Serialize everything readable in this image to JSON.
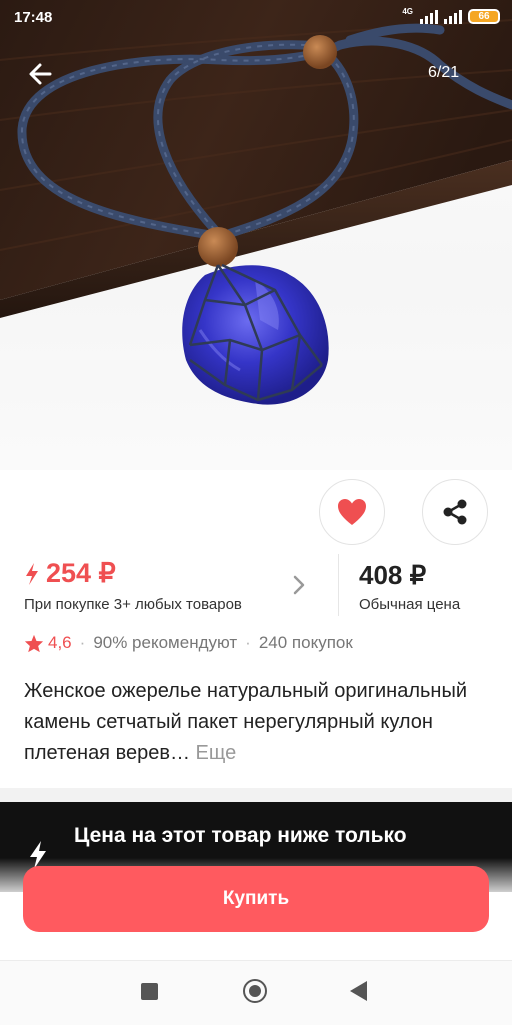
{
  "status": {
    "time": "17:48",
    "network": "4G",
    "battery": "66"
  },
  "gallery": {
    "counter": "6/21",
    "image_alt": "blue-crystal-necklace-photo"
  },
  "icons": {
    "back": "arrow-left-icon",
    "favorite": "heart-icon",
    "share": "share-icon",
    "promo": "lightning-icon",
    "chevron": "chevron-right-icon",
    "rating": "star-icon",
    "banner": "lightning-icon"
  },
  "price": {
    "promo": "254 ₽",
    "promo_condition": "При покупке 3+ любых товаров",
    "regular": "408 ₽",
    "regular_label": "Обычная цена"
  },
  "rating": {
    "value": "4,6",
    "recommend": "90% рекомендуют",
    "purchases": "240 покупок"
  },
  "product": {
    "title": "Женское ожерелье натуральный оригинальный камень сетчатый пакет нерегулярный кулон плетеная верев…",
    "more": "Еще"
  },
  "banner": {
    "text": "Цена на этот товар ниже только"
  },
  "buy_label": "Купить",
  "colors": {
    "accent": "#ef4f51",
    "buy_button": "#ff5a5f",
    "banner_bg": "#111111",
    "cord": "#3a4a6b",
    "stone": "#3a3acd"
  }
}
